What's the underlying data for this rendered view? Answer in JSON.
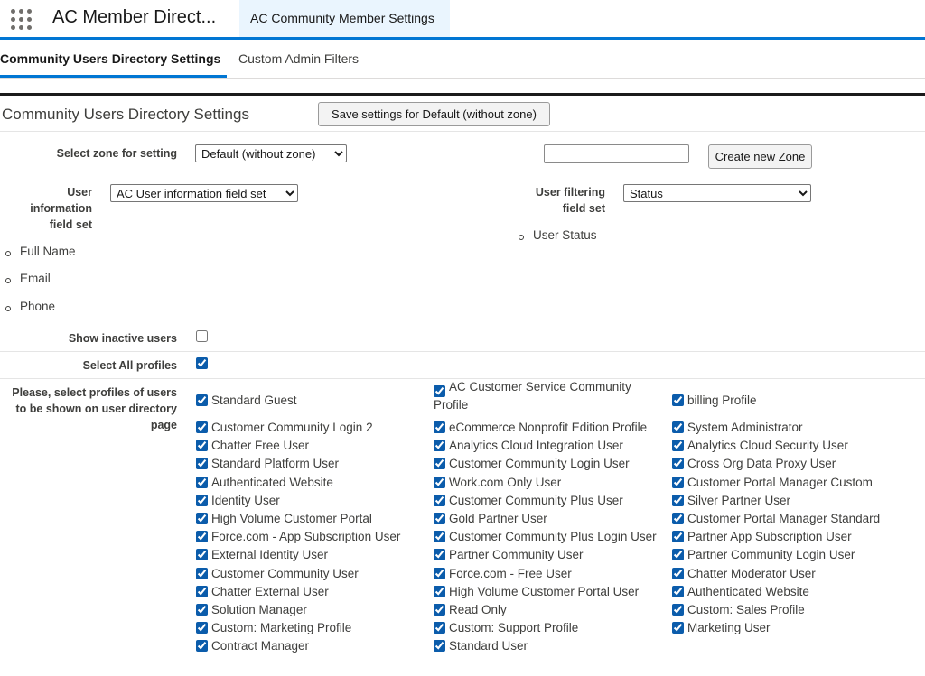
{
  "header": {
    "app_name": "AC Member Direct...",
    "active_tab": "AC Community Member Settings"
  },
  "subtabs": {
    "active": "Community Users Directory Settings",
    "other": "Custom Admin Filters"
  },
  "section": {
    "title": "Community Users Directory Settings",
    "save_button": "Save settings for Default (without zone)"
  },
  "zone": {
    "label": "Select zone for setting",
    "selected": "Default (without zone)",
    "new_zone_value": "",
    "create_button": "Create new Zone"
  },
  "user_info": {
    "label": "User information field set",
    "selected": "AC User information field set",
    "fields": [
      "Full Name",
      "Email",
      "Phone"
    ]
  },
  "user_filter": {
    "label": "User filtering field set",
    "selected": "Status",
    "fields": [
      "User Status"
    ]
  },
  "options": {
    "show_inactive_label": "Show inactive users",
    "show_inactive_checked": false,
    "select_all_label": "Select All profiles",
    "select_all_checked": true
  },
  "profiles": {
    "label": "Please, select profiles of users to be shown on user directory page",
    "columns": [
      [
        "Standard Guest",
        "Customer Community Login 2",
        "Chatter Free User",
        "Standard Platform User",
        "Authenticated Website",
        "Identity User",
        "High Volume Customer Portal",
        "Force.com - App Subscription User",
        "External Identity User",
        "Customer Community User",
        "Chatter External User",
        "Solution Manager",
        "Custom: Marketing Profile",
        "Contract Manager"
      ],
      [
        "AC Customer Service Community Profile",
        "eCommerce Nonprofit Edition Profile",
        "Analytics Cloud Integration User",
        "Customer Community Login User",
        "Work.com Only User",
        "Customer Community Plus User",
        "Gold Partner User",
        "Customer Community Plus Login User",
        "Partner Community User",
        "Force.com - Free User",
        "High Volume Customer Portal User",
        "Read Only",
        "Custom: Support Profile",
        "Standard User"
      ],
      [
        "billing Profile",
        "System Administrator",
        "Analytics Cloud Security User",
        "Cross Org Data Proxy User",
        "Customer Portal Manager Custom",
        "Silver Partner User",
        "Customer Portal Manager Standard",
        "Partner App Subscription User",
        "Partner Community Login User",
        "Chatter Moderator User",
        "Authenticated Website",
        "Custom: Sales Profile",
        "Marketing User"
      ]
    ]
  }
}
